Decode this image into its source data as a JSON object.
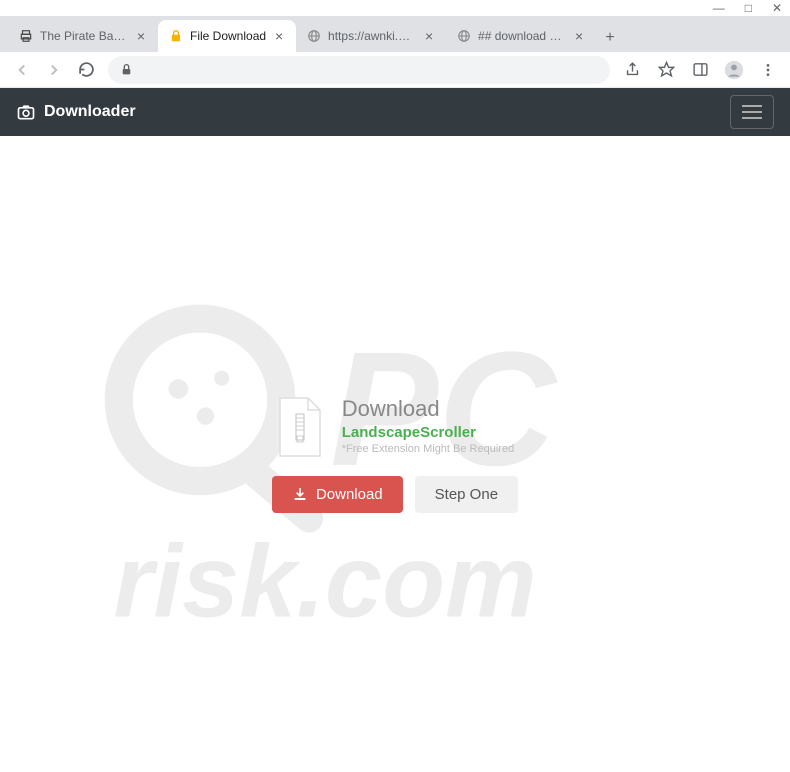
{
  "window": {
    "tabs": [
      {
        "title": "The Pirate Bay - The ga...",
        "active": false,
        "favicon": "printer"
      },
      {
        "title": "File Download",
        "active": true,
        "favicon": "lock-yellow"
      },
      {
        "title": "https://awnki.ofchildr.b...",
        "active": false,
        "favicon": "globe"
      },
      {
        "title": "## download page ##",
        "active": false,
        "favicon": "globe"
      }
    ]
  },
  "navbar": {
    "brand": "Downloader"
  },
  "download": {
    "heading": "Download",
    "name": "LandscapeScroller",
    "note": "*Free Extension Might Be Required",
    "download_btn": "Download",
    "step_btn": "Step One"
  }
}
